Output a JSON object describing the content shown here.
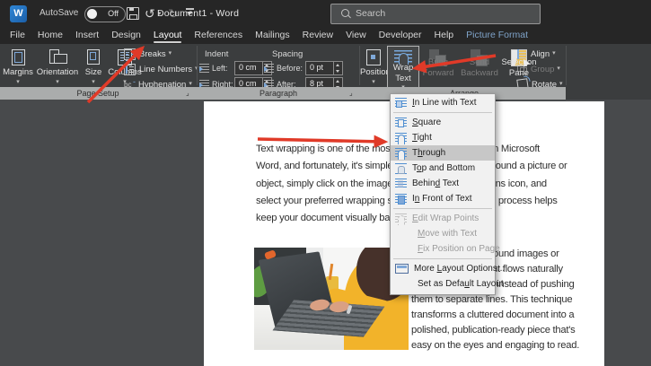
{
  "titlebar": {
    "autosave_label": "AutoSave",
    "autosave_state": "Off",
    "doc_title": "Document1 - Word",
    "search_placeholder": "Search"
  },
  "icons": {
    "undo": "↺",
    "redo": "↻"
  },
  "tabs": {
    "items": [
      {
        "label": "File"
      },
      {
        "label": "Home"
      },
      {
        "label": "Insert"
      },
      {
        "label": "Design"
      },
      {
        "label": "Layout",
        "selected": true
      },
      {
        "label": "References"
      },
      {
        "label": "Mailings"
      },
      {
        "label": "Review"
      },
      {
        "label": "View"
      },
      {
        "label": "Developer"
      },
      {
        "label": "Help"
      },
      {
        "label": "Picture Format",
        "contextual": true
      }
    ]
  },
  "ribbon": {
    "page_setup": {
      "group_label": "Page Setup",
      "margins": "Margins",
      "orientation": "Orientation",
      "size": "Size",
      "columns": "Columns",
      "breaks": "Breaks",
      "line_numbers": "Line Numbers",
      "hyphenation": "Hyphenation"
    },
    "paragraph": {
      "group_label": "Paragraph",
      "indent_label": "Indent",
      "spacing_label": "Spacing",
      "left_label": "Left:",
      "left_value": "0 cm",
      "right_label": "Right:",
      "right_value": "0 cm",
      "before_label": "Before:",
      "before_value": "0 pt",
      "after_label": "After:",
      "after_value": "8 pt"
    },
    "arrange": {
      "group_label": "Arrange",
      "position": "Position",
      "wrap_line1": "Wrap",
      "wrap_line2": "Text",
      "bring_line1": "Bring",
      "bring_line2": "Forward",
      "send_line1": "Send",
      "send_line2": "Backward",
      "selection_line1": "Selection",
      "selection_line2": "Pane",
      "align": "Align",
      "group": "Group",
      "rotate": "Rotate"
    }
  },
  "wrap_menu": {
    "items": [
      {
        "label": "In Line with Text",
        "accel": "I",
        "enabled": true
      },
      {
        "label": "Square",
        "accel": "S",
        "enabled": true
      },
      {
        "label": "Tight",
        "accel": "T",
        "enabled": true
      },
      {
        "label": "Through",
        "accel": "h",
        "enabled": true,
        "hovered": true
      },
      {
        "label": "Top and Bottom",
        "accel": "o",
        "enabled": true
      },
      {
        "label": "Behind Text",
        "accel": "d",
        "enabled": true
      },
      {
        "label": "In Front of Text",
        "accel": "n",
        "enabled": true
      },
      {
        "label": "Edit Wrap Points",
        "accel": "E",
        "enabled": false
      },
      {
        "label": "Move with Text",
        "accel": "M",
        "enabled": false
      },
      {
        "label": "Fix Position on Page",
        "accel": "F",
        "enabled": false
      },
      {
        "label": "More Layout Options...",
        "accel": "L",
        "enabled": true
      },
      {
        "label": "Set as Default Layout",
        "accel": "u",
        "enabled": true
      }
    ]
  },
  "document": {
    "p1_lines": [
      "Text wrapping is one of the most useful formatting tools in Microsoft",
      "Word, and fortunately, it's simple to apply. To wrap text around a picture or",
      "object, simply click on the image, select the Layout Options icon, and",
      "select your preferred wrapping style. This straightforward process helps",
      "keep your document visually balanced and easy to read."
    ],
    "p2_lines": [
      "By wrapping text around images or",
      "shapes, your content flows naturally",
      "around your visuals instead of pushing",
      "them to separate lines. This technique",
      "transforms a cluttered document into a",
      "polished, publication-ready piece that's",
      "easy on the eyes and engaging to read."
    ]
  },
  "colors": {
    "titlebar": "#262626",
    "ribbon": "#3b3d3e",
    "group_label_strip": "#aaacac",
    "canvas": "#484a4c",
    "accent_blue": "#4e8ed1",
    "contextual_tab": "#7fa3c9",
    "arrow_red": "#e03a28",
    "menu_bg": "#f1f1f1",
    "menu_hover": "#c7c7c7"
  }
}
